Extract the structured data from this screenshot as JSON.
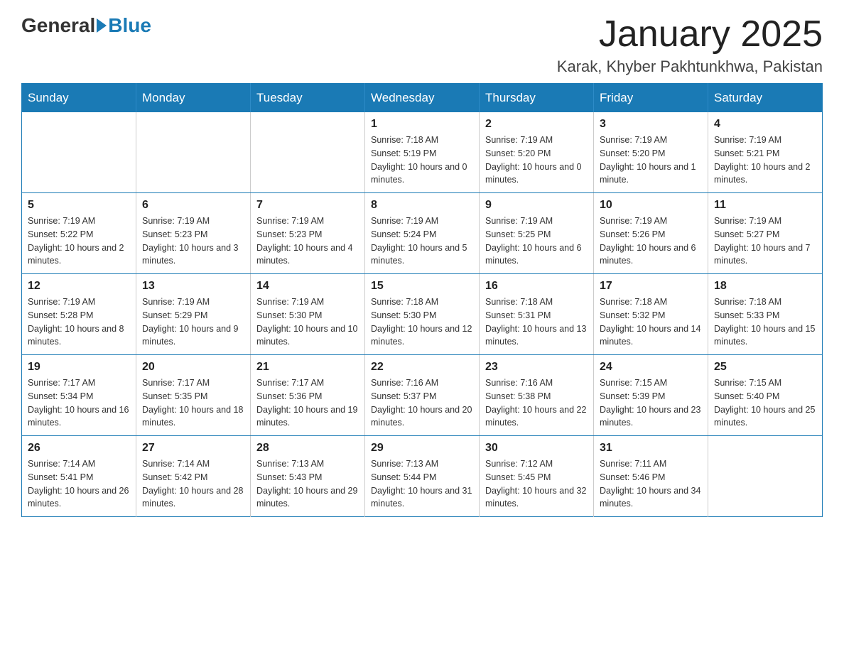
{
  "logo": {
    "general": "General",
    "blue": "Blue"
  },
  "title": "January 2025",
  "subtitle": "Karak, Khyber Pakhtunkhwa, Pakistan",
  "days_of_week": [
    "Sunday",
    "Monday",
    "Tuesday",
    "Wednesday",
    "Thursday",
    "Friday",
    "Saturday"
  ],
  "weeks": [
    [
      {
        "day": "",
        "sunrise": "",
        "sunset": "",
        "daylight": ""
      },
      {
        "day": "",
        "sunrise": "",
        "sunset": "",
        "daylight": ""
      },
      {
        "day": "",
        "sunrise": "",
        "sunset": "",
        "daylight": ""
      },
      {
        "day": "1",
        "sunrise": "Sunrise: 7:18 AM",
        "sunset": "Sunset: 5:19 PM",
        "daylight": "Daylight: 10 hours and 0 minutes."
      },
      {
        "day": "2",
        "sunrise": "Sunrise: 7:19 AM",
        "sunset": "Sunset: 5:20 PM",
        "daylight": "Daylight: 10 hours and 0 minutes."
      },
      {
        "day": "3",
        "sunrise": "Sunrise: 7:19 AM",
        "sunset": "Sunset: 5:20 PM",
        "daylight": "Daylight: 10 hours and 1 minute."
      },
      {
        "day": "4",
        "sunrise": "Sunrise: 7:19 AM",
        "sunset": "Sunset: 5:21 PM",
        "daylight": "Daylight: 10 hours and 2 minutes."
      }
    ],
    [
      {
        "day": "5",
        "sunrise": "Sunrise: 7:19 AM",
        "sunset": "Sunset: 5:22 PM",
        "daylight": "Daylight: 10 hours and 2 minutes."
      },
      {
        "day": "6",
        "sunrise": "Sunrise: 7:19 AM",
        "sunset": "Sunset: 5:23 PM",
        "daylight": "Daylight: 10 hours and 3 minutes."
      },
      {
        "day": "7",
        "sunrise": "Sunrise: 7:19 AM",
        "sunset": "Sunset: 5:23 PM",
        "daylight": "Daylight: 10 hours and 4 minutes."
      },
      {
        "day": "8",
        "sunrise": "Sunrise: 7:19 AM",
        "sunset": "Sunset: 5:24 PM",
        "daylight": "Daylight: 10 hours and 5 minutes."
      },
      {
        "day": "9",
        "sunrise": "Sunrise: 7:19 AM",
        "sunset": "Sunset: 5:25 PM",
        "daylight": "Daylight: 10 hours and 6 minutes."
      },
      {
        "day": "10",
        "sunrise": "Sunrise: 7:19 AM",
        "sunset": "Sunset: 5:26 PM",
        "daylight": "Daylight: 10 hours and 6 minutes."
      },
      {
        "day": "11",
        "sunrise": "Sunrise: 7:19 AM",
        "sunset": "Sunset: 5:27 PM",
        "daylight": "Daylight: 10 hours and 7 minutes."
      }
    ],
    [
      {
        "day": "12",
        "sunrise": "Sunrise: 7:19 AM",
        "sunset": "Sunset: 5:28 PM",
        "daylight": "Daylight: 10 hours and 8 minutes."
      },
      {
        "day": "13",
        "sunrise": "Sunrise: 7:19 AM",
        "sunset": "Sunset: 5:29 PM",
        "daylight": "Daylight: 10 hours and 9 minutes."
      },
      {
        "day": "14",
        "sunrise": "Sunrise: 7:19 AM",
        "sunset": "Sunset: 5:30 PM",
        "daylight": "Daylight: 10 hours and 10 minutes."
      },
      {
        "day": "15",
        "sunrise": "Sunrise: 7:18 AM",
        "sunset": "Sunset: 5:30 PM",
        "daylight": "Daylight: 10 hours and 12 minutes."
      },
      {
        "day": "16",
        "sunrise": "Sunrise: 7:18 AM",
        "sunset": "Sunset: 5:31 PM",
        "daylight": "Daylight: 10 hours and 13 minutes."
      },
      {
        "day": "17",
        "sunrise": "Sunrise: 7:18 AM",
        "sunset": "Sunset: 5:32 PM",
        "daylight": "Daylight: 10 hours and 14 minutes."
      },
      {
        "day": "18",
        "sunrise": "Sunrise: 7:18 AM",
        "sunset": "Sunset: 5:33 PM",
        "daylight": "Daylight: 10 hours and 15 minutes."
      }
    ],
    [
      {
        "day": "19",
        "sunrise": "Sunrise: 7:17 AM",
        "sunset": "Sunset: 5:34 PM",
        "daylight": "Daylight: 10 hours and 16 minutes."
      },
      {
        "day": "20",
        "sunrise": "Sunrise: 7:17 AM",
        "sunset": "Sunset: 5:35 PM",
        "daylight": "Daylight: 10 hours and 18 minutes."
      },
      {
        "day": "21",
        "sunrise": "Sunrise: 7:17 AM",
        "sunset": "Sunset: 5:36 PM",
        "daylight": "Daylight: 10 hours and 19 minutes."
      },
      {
        "day": "22",
        "sunrise": "Sunrise: 7:16 AM",
        "sunset": "Sunset: 5:37 PM",
        "daylight": "Daylight: 10 hours and 20 minutes."
      },
      {
        "day": "23",
        "sunrise": "Sunrise: 7:16 AM",
        "sunset": "Sunset: 5:38 PM",
        "daylight": "Daylight: 10 hours and 22 minutes."
      },
      {
        "day": "24",
        "sunrise": "Sunrise: 7:15 AM",
        "sunset": "Sunset: 5:39 PM",
        "daylight": "Daylight: 10 hours and 23 minutes."
      },
      {
        "day": "25",
        "sunrise": "Sunrise: 7:15 AM",
        "sunset": "Sunset: 5:40 PM",
        "daylight": "Daylight: 10 hours and 25 minutes."
      }
    ],
    [
      {
        "day": "26",
        "sunrise": "Sunrise: 7:14 AM",
        "sunset": "Sunset: 5:41 PM",
        "daylight": "Daylight: 10 hours and 26 minutes."
      },
      {
        "day": "27",
        "sunrise": "Sunrise: 7:14 AM",
        "sunset": "Sunset: 5:42 PM",
        "daylight": "Daylight: 10 hours and 28 minutes."
      },
      {
        "day": "28",
        "sunrise": "Sunrise: 7:13 AM",
        "sunset": "Sunset: 5:43 PM",
        "daylight": "Daylight: 10 hours and 29 minutes."
      },
      {
        "day": "29",
        "sunrise": "Sunrise: 7:13 AM",
        "sunset": "Sunset: 5:44 PM",
        "daylight": "Daylight: 10 hours and 31 minutes."
      },
      {
        "day": "30",
        "sunrise": "Sunrise: 7:12 AM",
        "sunset": "Sunset: 5:45 PM",
        "daylight": "Daylight: 10 hours and 32 minutes."
      },
      {
        "day": "31",
        "sunrise": "Sunrise: 7:11 AM",
        "sunset": "Sunset: 5:46 PM",
        "daylight": "Daylight: 10 hours and 34 minutes."
      },
      {
        "day": "",
        "sunrise": "",
        "sunset": "",
        "daylight": ""
      }
    ]
  ]
}
